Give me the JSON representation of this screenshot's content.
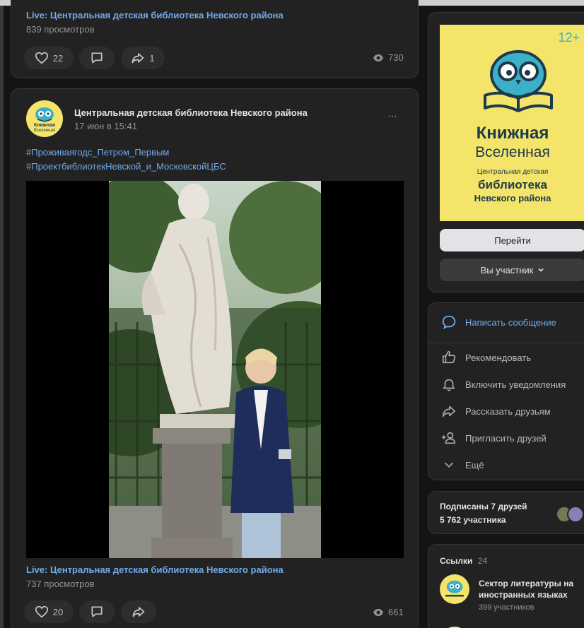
{
  "post1": {
    "live_title": "Live: Центральная детская библиотека Невского района",
    "views_text": "839 просмотров",
    "likes": "22",
    "shares": "1",
    "view_count": "730"
  },
  "post2": {
    "author": "Центральная детская библиотека Невского района",
    "date": "17 июн в 15:41",
    "hashtag1": "#Проживаягодс_Петром_Первым",
    "hashtag2": "#ПроектбиблиотекНевской_и_МосковскойЦБС",
    "live_title": "Live: Центральная детская библиотека Невского района",
    "views_text": "737 просмотров",
    "likes": "20",
    "view_count": "661",
    "more": "···"
  },
  "logo": {
    "small_line1": "Книжная",
    "small_line2": "Вселенная"
  },
  "cover": {
    "age": "12+",
    "line1": "Книжная",
    "line2": "Вселенная",
    "line3": "Центральная детская",
    "line4": "библиотека",
    "line5": "Невского района"
  },
  "actions": {
    "goto": "Перейти",
    "member": "Вы участник"
  },
  "menu": {
    "write": "Написать сообщение",
    "recommend": "Рекомендовать",
    "notify": "Включить уведомления",
    "tell": "Рассказать друзьям",
    "invite": "Пригласить друзей",
    "more": "Ещё"
  },
  "friends": {
    "text": "Подписаны 7 друзей",
    "members": "5 762 участника"
  },
  "links": {
    "title": "Ссылки",
    "count": "24",
    "item1_line1": "Сектор литературы на",
    "item1_line2": "иностранных языках",
    "item1_members": "399 участников"
  },
  "colors": {
    "accent": "#71aaeb",
    "logo_yellow": "#f4e46a",
    "owl_teal": "#3db0c9"
  }
}
